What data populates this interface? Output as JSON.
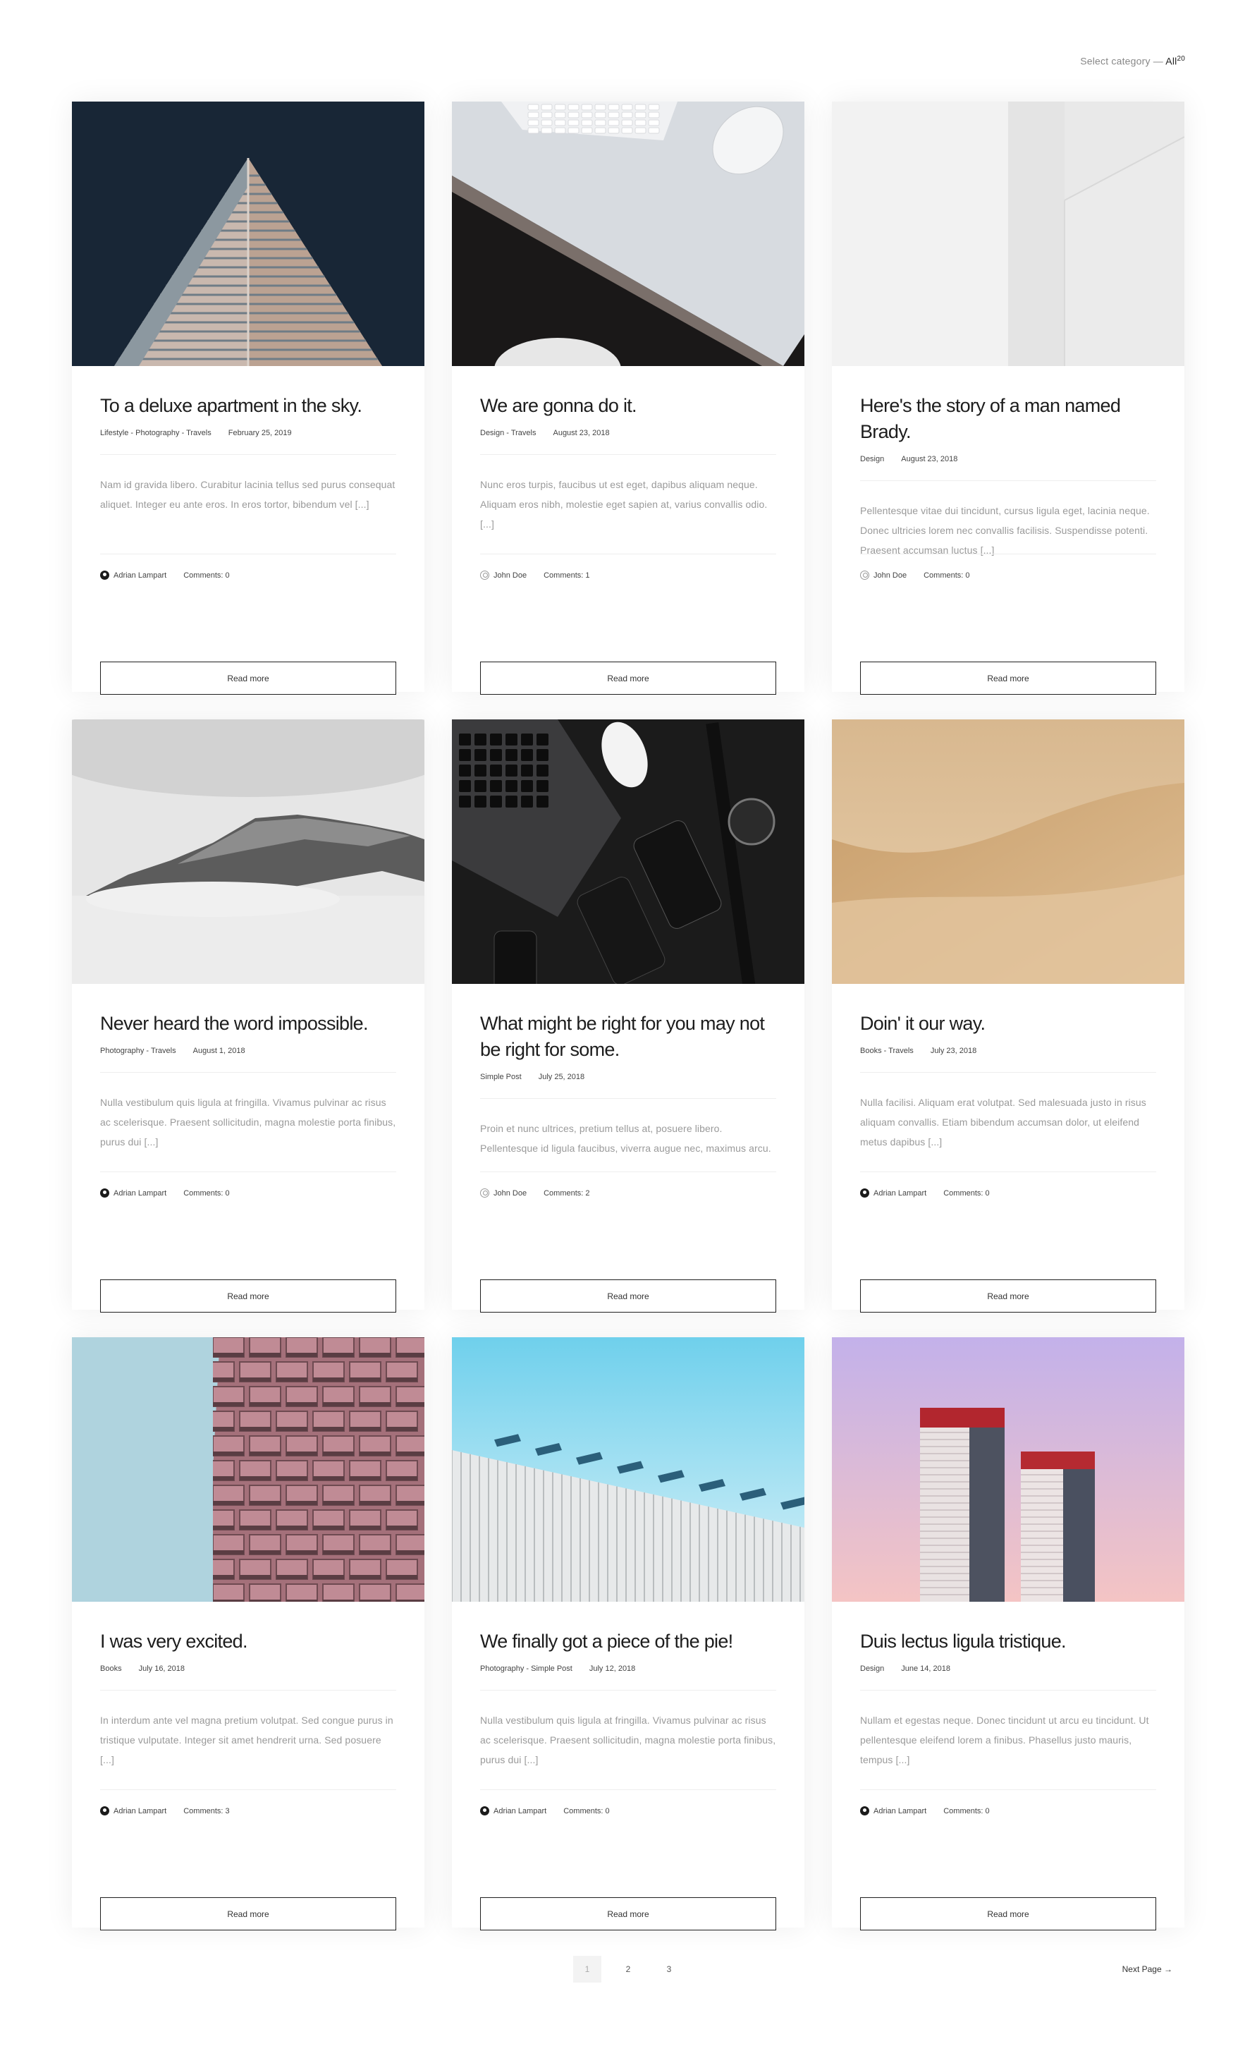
{
  "filter": {
    "label": "Select category — ",
    "value": "All",
    "count": "20"
  },
  "read_more_label": "Read more",
  "posts": [
    {
      "title": "To a deluxe apartment in the sky.",
      "categories": "Lifestyle - Photography - Travels",
      "date": "February 25, 2019",
      "excerpt": "Nam id gravida libero. Curabitur lacinia tellus sed purus consequat aliquet. Integer eu ante eros. In eros tortor, bibendum vel [...]",
      "author": "Adrian Lampart",
      "avatar": "dark",
      "comments": "Comments: 0",
      "image": "triangle-building"
    },
    {
      "title": "We are gonna do it.",
      "categories": "Design - Travels",
      "date": "August 23, 2018",
      "excerpt": "Nunc eros turpis, faucibus ut est eget, dapibus aliquam neque. Aliquam eros nibh, molestie eget sapien at, varius convallis odio. [...]",
      "author": "John Doe",
      "avatar": "outline",
      "comments": "Comments: 1",
      "image": "desk-keyboard"
    },
    {
      "title": "Here's the story of a man named Brady.",
      "categories": "Design",
      "date": "August 23, 2018",
      "excerpt": "Pellentesque vitae dui tincidunt, cursus ligula eget, lacinia neque. Donec ultricies lorem nec convallis facilisis. Suspendisse potenti. Praesent accumsan luctus [...]",
      "author": "John Doe",
      "avatar": "outline",
      "comments": "Comments: 0",
      "image": "white-wall"
    },
    {
      "title": "Never heard the word impossible.",
      "categories": "Photography - Travels",
      "date": "August 1, 2018",
      "excerpt": "Nulla vestibulum quis ligula at fringilla. Vivamus pulvinar ac risus ac scelerisque. Praesent sollicitudin, magna molestie porta finibus, purus dui [...]",
      "author": "Adrian Lampart",
      "avatar": "dark",
      "comments": "Comments: 0",
      "image": "foggy-mountain"
    },
    {
      "title": "What might be right for you may not be right for some.",
      "categories": "Simple Post",
      "date": "July 25, 2018",
      "excerpt": "Proin et nunc ultrices, pretium tellus at, posuere libero. Pellentesque id ligula faucibus, viverra augue nec, maximus arcu.",
      "author": "John Doe",
      "avatar": "outline",
      "comments": "Comments: 2",
      "image": "dark-gadgets"
    },
    {
      "title": "Doin' it our way.",
      "categories": "Books - Travels",
      "date": "July 23, 2018",
      "excerpt": "Nulla facilisi. Aliquam erat volutpat. Sed malesuada justo in risus aliquam convallis. Etiam bibendum accumsan dolor, ut eleifend metus dapibus [...]",
      "author": "Adrian Lampart",
      "avatar": "dark",
      "comments": "Comments: 0",
      "image": "sand-dune"
    },
    {
      "title": "I was very excited.",
      "categories": "Books",
      "date": "July 16, 2018",
      "excerpt": "In interdum ante vel magna pretium volutpat. Sed congue purus in tristique vulputate. Integer sit amet hendrerit urna. Sed posuere [...]",
      "author": "Adrian Lampart",
      "avatar": "dark",
      "comments": "Comments: 3",
      "image": "pink-facade"
    },
    {
      "title": "We finally got a piece of the pie!",
      "categories": "Photography - Simple Post",
      "date": "July 12, 2018",
      "excerpt": "Nulla vestibulum quis ligula at fringilla. Vivamus pulvinar ac risus ac scelerisque. Praesent sollicitudin, magna molestie porta finibus, purus dui [...]",
      "author": "Adrian Lampart",
      "avatar": "dark",
      "comments": "Comments: 0",
      "image": "solar-roof"
    },
    {
      "title": "Duis lectus ligula tristique.",
      "categories": "Design",
      "date": "June 14, 2018",
      "excerpt": "Nullam et egestas neque. Donec tincidunt ut arcu eu tincidunt. Ut pellentesque eleifend lorem a finibus. Phasellus justo mauris, tempus [...]",
      "author": "Adrian Lampart",
      "avatar": "dark",
      "comments": "Comments: 0",
      "image": "twin-towers"
    }
  ],
  "pagination": {
    "pages": [
      "1",
      "2",
      "3"
    ],
    "current": "1",
    "next_label": "Next Page →"
  }
}
